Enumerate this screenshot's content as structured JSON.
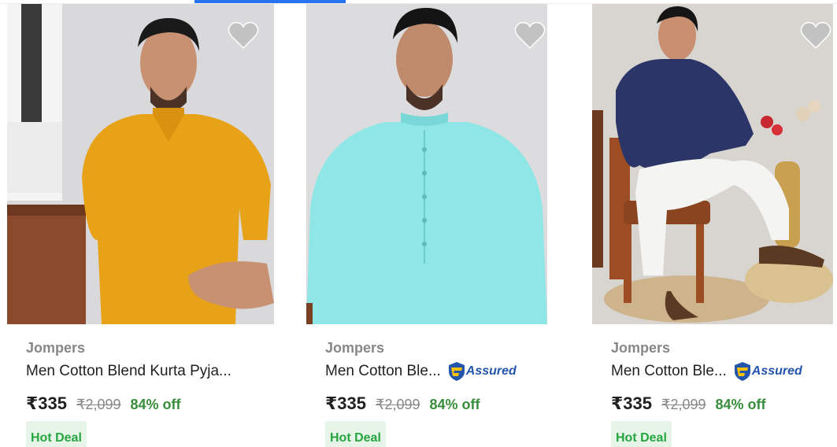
{
  "products": [
    {
      "brand": "Jompers",
      "title": "Men Cotton Blend Kurta Pyja...",
      "assured": false,
      "assured_label": "",
      "price": "₹335",
      "mrp": "₹2,099",
      "discount": "84% off",
      "deal_tag": "Hot Deal",
      "kurta_color": "#e7a218"
    },
    {
      "brand": "Jompers",
      "title": "Men Cotton Ble...",
      "assured": true,
      "assured_label": "Assured",
      "price": "₹335",
      "mrp": "₹2,099",
      "discount": "84% off",
      "deal_tag": "Hot Deal",
      "kurta_color": "#8fe6e6"
    },
    {
      "brand": "Jompers",
      "title": "Men Cotton Ble...",
      "assured": true,
      "assured_label": "Assured",
      "price": "₹335",
      "mrp": "₹2,099",
      "discount": "84% off",
      "deal_tag": "Hot Deal",
      "kurta_color": "#2c3567"
    }
  ],
  "icons": {
    "wishlist": "heart-icon",
    "assured": "flipkart-assured-icon"
  }
}
